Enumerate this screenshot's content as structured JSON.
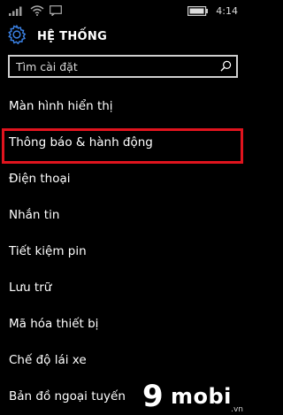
{
  "status_bar": {
    "time": "4:14",
    "icons": [
      "signal-bars-icon",
      "wifi-icon",
      "message-icon",
      "battery-icon"
    ]
  },
  "header": {
    "title": "HỆ THỐNG",
    "icon": "gear-icon"
  },
  "search": {
    "placeholder": "Tìm cài đặt",
    "value": "",
    "icon": "search-icon"
  },
  "menu": {
    "items": [
      {
        "label": "Màn hình hiển thị"
      },
      {
        "label": "Thông báo & hành động",
        "highlighted": true
      },
      {
        "label": "Điện thoại"
      },
      {
        "label": "Nhắn tin"
      },
      {
        "label": "Tiết kiệm pin"
      },
      {
        "label": "Lưu trữ"
      },
      {
        "label": "Mã hóa thiết bị"
      },
      {
        "label": "Chế độ lái xe"
      },
      {
        "label": "Bản đồ ngoại tuyến"
      }
    ]
  },
  "watermark": {
    "nine": "9",
    "word": "mobi",
    "suffix": ".vn"
  },
  "colors": {
    "background": "#000000",
    "text": "#ffffff",
    "accent": "#3b82e6",
    "highlight_border": "#e0141e",
    "search_border": "#cfcfcf"
  }
}
